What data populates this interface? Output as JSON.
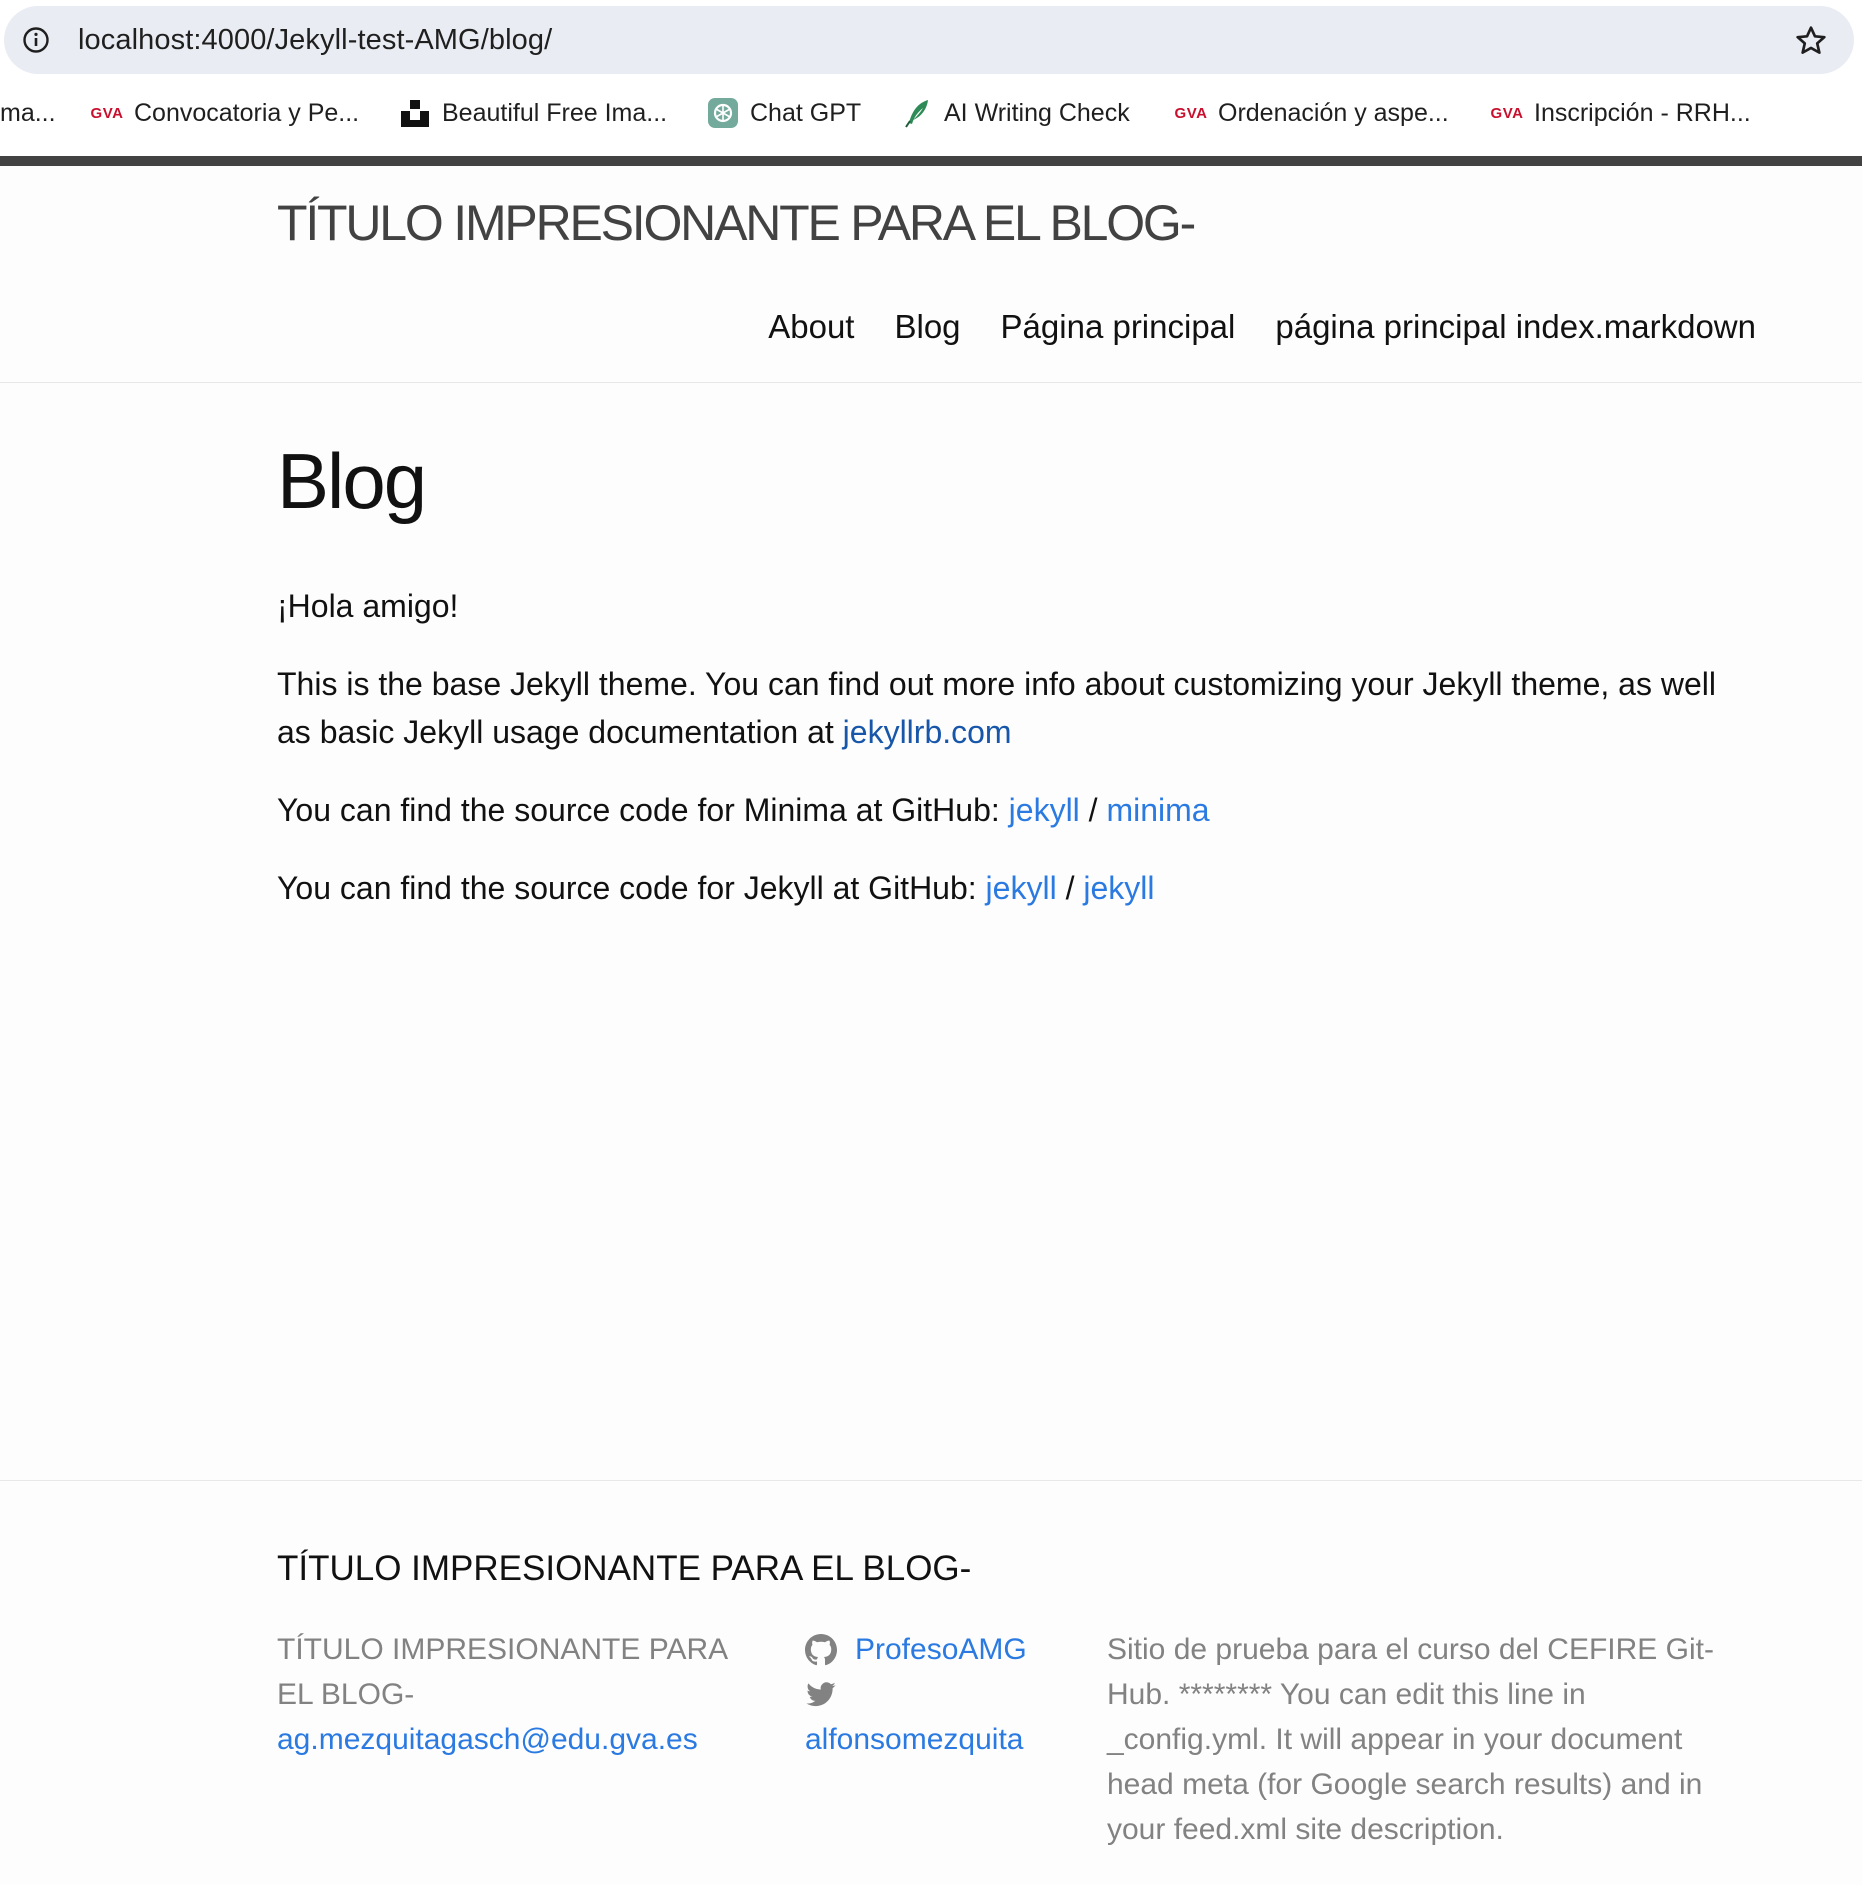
{
  "browser": {
    "url": "localhost:4000/Jekyll-test-AMG/blog/",
    "bookmarks": [
      {
        "label": "ma..."
      },
      {
        "label": "Convocatoria y Pe...",
        "icon": "gva-icon",
        "icon_text": "GVA"
      },
      {
        "label": "Beautiful Free Ima...",
        "icon": "unsplash-icon"
      },
      {
        "label": "Chat GPT",
        "icon": "chatgpt-icon"
      },
      {
        "label": "AI Writing Check",
        "icon": "quill-icon"
      },
      {
        "label": "Ordenación y aspe...",
        "icon": "gva-icon",
        "icon_text": "GVA"
      },
      {
        "label": "Inscripción - RRH...",
        "icon": "gva-icon",
        "icon_text": "GVA"
      }
    ]
  },
  "header": {
    "site_title": "TÍTULO IMPRESIONANTE PARA EL BLOG-",
    "nav": [
      "About",
      "Blog",
      "Página principal",
      "página principal index.markdown"
    ]
  },
  "main": {
    "heading": "Blog",
    "greeting": "¡Hola amigo!",
    "p2_text": "This is the base Jekyll theme. You can find out more info about customizing your Jekyll theme, as well as basic Jekyll usage documentation at ",
    "p2_link": "jekyllrb.com",
    "p3_text": "You can find the source code for Minima at GitHub: ",
    "p3_link1": "jekyll",
    "p3_sep": " / ",
    "p3_link2": "minima",
    "p4_text": "You can find the source code for Jekyll at GitHub: ",
    "p4_link1": "jekyll",
    "p4_sep": " / ",
    "p4_link2": "jekyll"
  },
  "footer": {
    "heading": "TÍTULO IMPRESIONANTE PARA EL BLOG-",
    "name": "TÍTULO IMPRESIONANTE PARA EL BLOG-",
    "email": "ag.mezquitagasch@edu.gva.es",
    "github_user": "ProfesoAMG",
    "twitter_user": "alfonsomezquita",
    "description": "Sitio de prueba para el curso del CEFIRE Git-Hub. ******** You can edit this line in _config.yml. It will appear in your document head meta (for Google search results) and in your feed.xml site description."
  },
  "colors": {
    "link": "#2a7ae2",
    "muted_text": "#828282",
    "top_bar": "#424242",
    "gva_red": "#c8102e"
  }
}
